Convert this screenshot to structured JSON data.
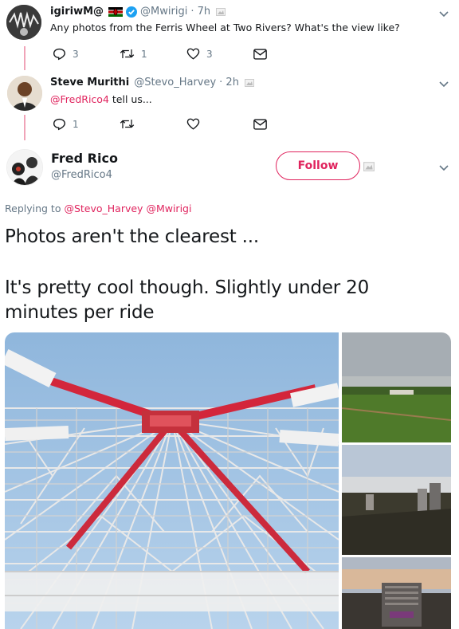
{
  "tweet1": {
    "name": "igiriwM@",
    "handle": "@Mwirigi",
    "time": "· 7h",
    "text": "Any photos from the Ferris Wheel at Two Rivers? What's the view like?",
    "replies": "3",
    "retweets": "1",
    "likes": "3"
  },
  "tweet2": {
    "name": "Steve Murithi",
    "handle": "@Stevo_Harvey",
    "time": "· 2h",
    "mention": "@FredRico4",
    "text": " tell us...",
    "replies": "1"
  },
  "tweet3": {
    "name": "Fred Rico",
    "handle": "@FredRico4",
    "follow_label": "Follow",
    "replying_prefix": "Replying to ",
    "replying_to_1": "@Stevo_Harvey",
    "replying_to_2": "@Mwirigi",
    "line1": "Photos aren't the clearest ...",
    "line2": "It's pretty cool though. Slightly under 20",
    "line3": "minutes per ride"
  },
  "colors": {
    "accent": "#e0245e",
    "verified": "#1da1f2",
    "muted": "#657786"
  }
}
